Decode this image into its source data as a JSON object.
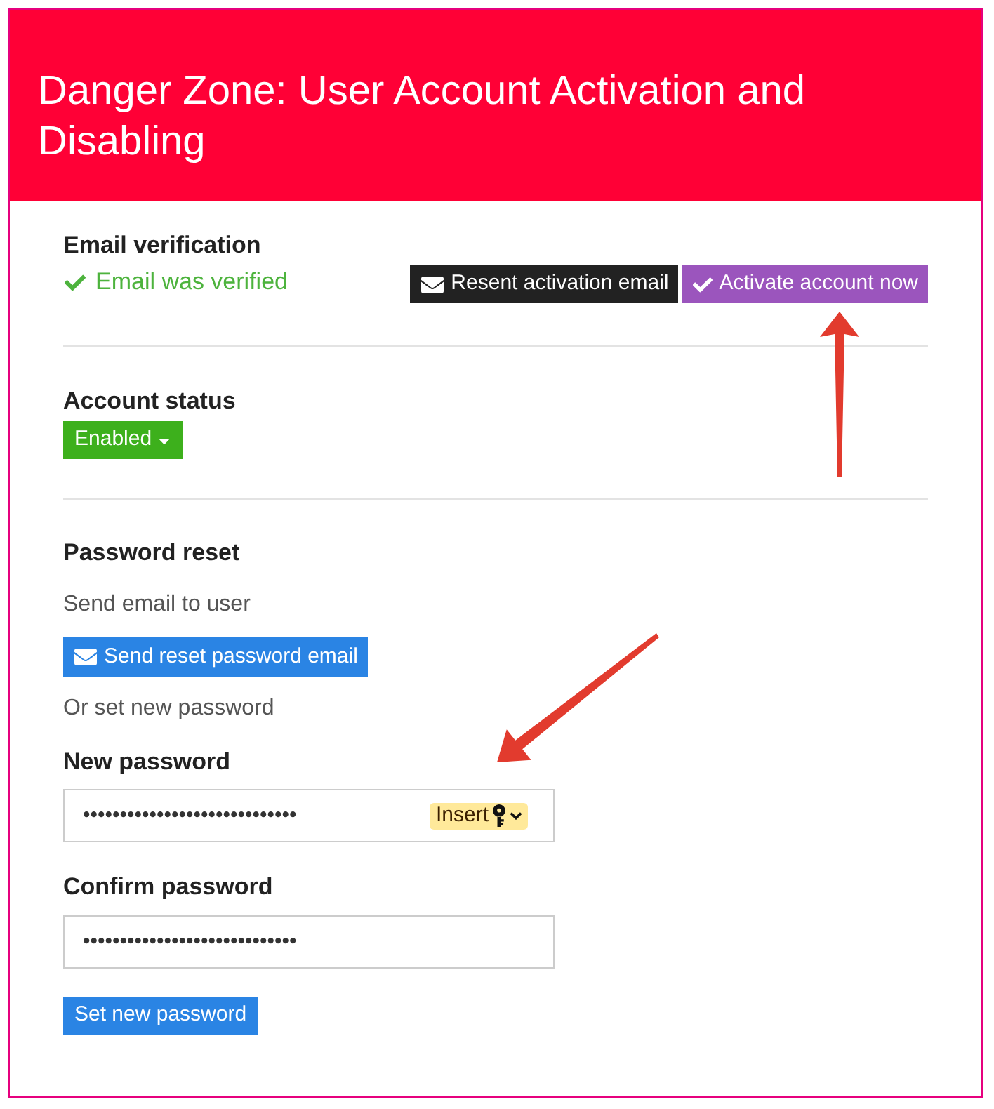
{
  "header": {
    "title": "Danger Zone: User Account Activation and Disabling"
  },
  "email_verification": {
    "heading": "Email verification",
    "status": {
      "text": "Email was verified",
      "verified": true
    },
    "buttons": [
      {
        "kind": "resend",
        "label": "Resent activation email"
      },
      {
        "kind": "activate",
        "label": "Activate account now"
      }
    ]
  },
  "account_status": {
    "heading": "Account status",
    "dropdown": {
      "label": "Enabled",
      "enabled": true
    }
  },
  "password_reset": {
    "heading": "Password reset",
    "send_email_text": "Send email to user",
    "send_button": "Send reset password email",
    "alternative_text": "Or set new password",
    "fields": [
      {
        "kind": "generator",
        "label": "New password",
        "value": "•••••••••••••••••••••••••••••",
        "badge": "Insert"
      },
      {
        "kind": "plain",
        "label": "Confirm password",
        "value": "•••••••••••••••••••••••••••••"
      }
    ],
    "submit_button": "Set new password"
  }
}
